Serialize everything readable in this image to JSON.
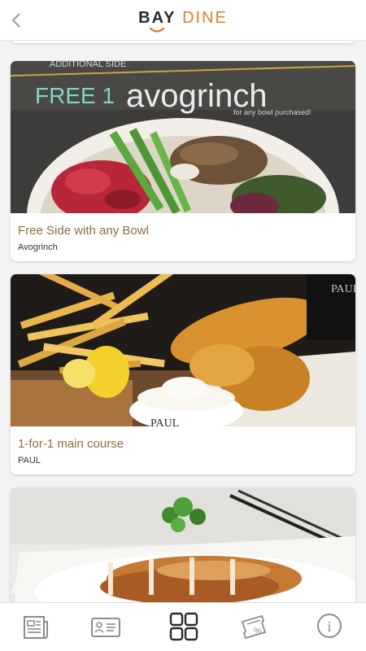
{
  "header": {
    "logo_part1": "BAY",
    "logo_part2": "DINE",
    "brand_color": "#e07a2b"
  },
  "deals": [
    {
      "image_text_top": "ADDITIONAL SIDE",
      "image_text_main": "FREE 1",
      "image_text_brand": "avogrinch",
      "image_text_sub": "for any bowl purchased!",
      "title": "Free Side with any Bowl",
      "merchant": "Avogrinch"
    },
    {
      "image_text_brand": "PAUL",
      "title": "1-for-1 main course",
      "merchant": "PAUL"
    },
    {
      "title": "",
      "merchant": ""
    }
  ],
  "tabbar": {
    "tabs": [
      {
        "icon": "newspaper-icon"
      },
      {
        "icon": "member-card-icon"
      },
      {
        "icon": "grid-icon",
        "active": true
      },
      {
        "icon": "voucher-icon"
      },
      {
        "icon": "info-icon"
      }
    ],
    "info_glyph": "i",
    "voucher_glyph": "%"
  },
  "colors": {
    "title_text": "#8a6e3b",
    "icon_gray": "#8c8c8c",
    "icon_active": "#2a2a2a"
  }
}
